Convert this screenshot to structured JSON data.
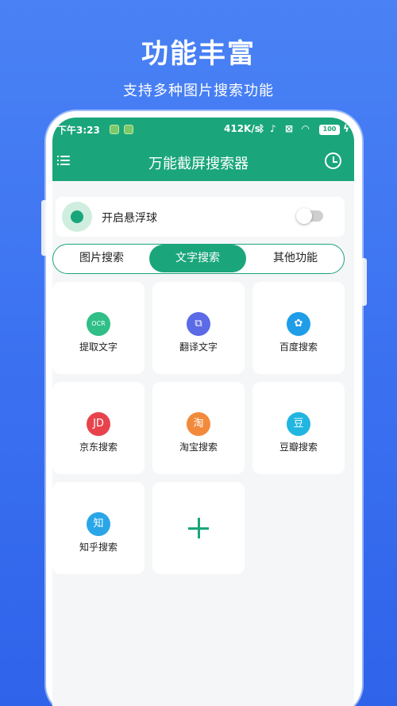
{
  "hero": {
    "title": "功能丰富",
    "subtitle": "支持多种图片搜索功能"
  },
  "statusbar": {
    "time": "下午3:23",
    "speed": "412K/s",
    "battery": "100"
  },
  "header": {
    "title": "万能截屏搜索器",
    "menu_icon": "menu-icon",
    "history_icon": "clock-icon"
  },
  "float_ball": {
    "label": "开启悬浮球",
    "enabled": false
  },
  "tabs": [
    {
      "label": "图片搜索",
      "active": false
    },
    {
      "label": "文字搜索",
      "active": true
    },
    {
      "label": "其他功能",
      "active": false
    }
  ],
  "functions": [
    {
      "label": "提取文字",
      "icon": "ocr-icon",
      "glyph": "OCR",
      "color": "#2fbf87"
    },
    {
      "label": "翻译文字",
      "icon": "translate-icon",
      "glyph": "⧉",
      "color": "#5b6ae6"
    },
    {
      "label": "百度搜索",
      "icon": "baidu-icon",
      "glyph": "✿",
      "color": "#1f9de8"
    },
    {
      "label": "京东搜索",
      "icon": "jd-icon",
      "glyph": "JD",
      "color": "#e8434c"
    },
    {
      "label": "淘宝搜索",
      "icon": "taobao-icon",
      "glyph": "淘",
      "color": "#f28a3c"
    },
    {
      "label": "豆瓣搜索",
      "icon": "douban-icon",
      "glyph": "豆",
      "color": "#21b6e0"
    },
    {
      "label": "知乎搜索",
      "icon": "zhihu-icon",
      "glyph": "知",
      "color": "#2aa6e8"
    }
  ],
  "add_button": {
    "icon": "plus-icon"
  }
}
